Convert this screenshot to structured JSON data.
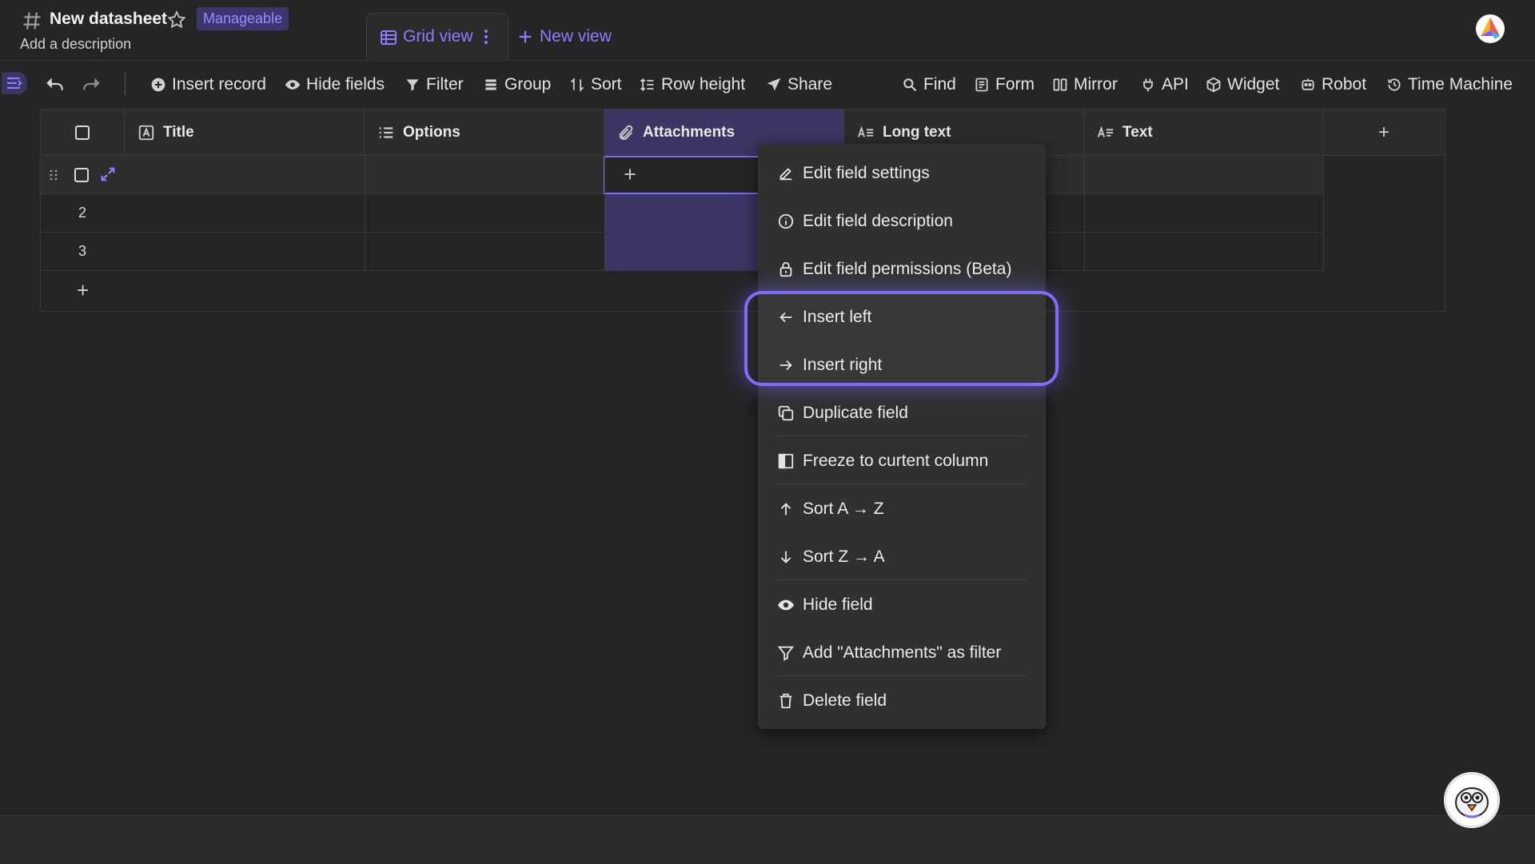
{
  "header": {
    "title": "New datasheet",
    "permission_badge": "Manageable",
    "description_placeholder": "Add a description",
    "tabs": [
      {
        "label": "Grid view",
        "active": true
      }
    ],
    "new_view_label": "New view"
  },
  "toolbar": {
    "insert_record": "Insert record",
    "hide_fields": "Hide fields",
    "filter": "Filter",
    "group": "Group",
    "sort": "Sort",
    "row_height": "Row height",
    "share": "Share",
    "find": "Find",
    "form": "Form",
    "mirror": "Mirror",
    "api": "API",
    "widget": "Widget",
    "robot": "Robot",
    "time_machine": "Time Machine"
  },
  "grid": {
    "columns": [
      {
        "label": "Title",
        "icon": "text-field-icon"
      },
      {
        "label": "Options",
        "icon": "options-field-icon"
      },
      {
        "label": "Attachments",
        "icon": "attachment-field-icon",
        "selected": true
      },
      {
        "label": "Long text",
        "icon": "long-text-field-icon"
      },
      {
        "label": "Text",
        "icon": "text-field-icon"
      }
    ],
    "rows": [
      {
        "number": "",
        "editing": true
      },
      {
        "number": "2"
      },
      {
        "number": "3"
      }
    ],
    "add_row_symbol": "+",
    "add_column_symbol": "+"
  },
  "context_menu": {
    "items": [
      {
        "label": "Edit field settings",
        "icon": "pencil-icon"
      },
      {
        "label": "Edit field description",
        "icon": "info-icon"
      },
      {
        "label": "Edit field permissions (Beta)",
        "icon": "lock-icon"
      },
      {
        "label": "Insert left",
        "icon": "arrow-left-icon"
      },
      {
        "label": "Insert right",
        "icon": "arrow-right-icon"
      },
      {
        "label": "Duplicate field",
        "icon": "copy-icon"
      },
      {
        "label": "Freeze to curtent column",
        "icon": "freeze-icon"
      },
      {
        "label": "Sort A → Z",
        "icon": "arrow-up-icon"
      },
      {
        "label": "Sort Z → A",
        "icon": "arrow-down-icon"
      },
      {
        "label": "Hide field",
        "icon": "eye-icon"
      },
      {
        "label": "Add \"Attachments\" as filter",
        "icon": "filter-icon"
      },
      {
        "label": "Delete field",
        "icon": "trash-icon"
      }
    ]
  },
  "colors": {
    "accent": "#8f7bff",
    "background": "#252526",
    "selected_column": "#3b3663",
    "menu_background": "#303031"
  }
}
